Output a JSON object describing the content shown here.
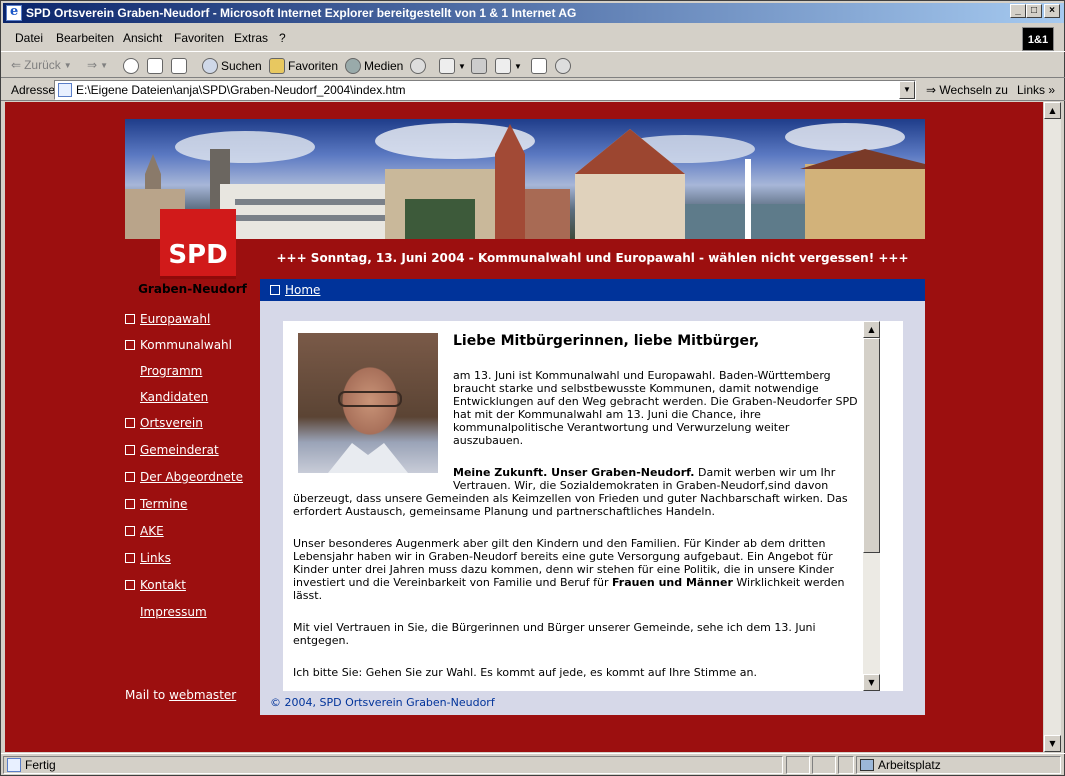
{
  "window": {
    "title": "SPD Ortsverein Graben-Neudorf - Microsoft Internet Explorer bereitgestellt von 1 & 1 Internet AG"
  },
  "menu": [
    "Datei",
    "Bearbeiten",
    "Ansicht",
    "Favoriten",
    "Extras",
    "?"
  ],
  "brand_logo": "1&1",
  "toolbar": {
    "back": "Zurück",
    "search": "Suchen",
    "favorites": "Favoriten",
    "media": "Medien"
  },
  "address": {
    "label": "Adresse",
    "value": "E:\\Eigene Dateien\\anja\\SPD\\Graben-Neudorf_2004\\index.htm",
    "go": "Wechseln zu",
    "links": "Links"
  },
  "page": {
    "logo_text": "SPD",
    "announcement": "+++ Sonntag, 13. Juni 2004 - Kommunalwahl und Europawahl - wählen nicht vergessen! +++",
    "org_name": "Graben-Neudorf",
    "nav": [
      {
        "label": "Europawahl",
        "checkbox": true,
        "link": true
      },
      {
        "label": "Kommunalwahl",
        "checkbox": true,
        "link": false
      },
      {
        "label": "Programm",
        "checkbox": false,
        "link": true,
        "sub": true
      },
      {
        "label": "Kandidaten",
        "checkbox": false,
        "link": true,
        "sub": true
      },
      {
        "label": "Ortsverein",
        "checkbox": true,
        "link": true
      },
      {
        "label": "Gemeinderat",
        "checkbox": true,
        "link": true
      },
      {
        "label": "Der Abgeordnete",
        "checkbox": true,
        "link": true
      },
      {
        "label": "Termine",
        "checkbox": true,
        "link": true
      },
      {
        "label": "AKE",
        "checkbox": true,
        "link": true
      },
      {
        "label": "Links",
        "checkbox": true,
        "link": true
      },
      {
        "label": "Kontakt",
        "checkbox": true,
        "link": true
      },
      {
        "label": "Impressum",
        "checkbox": false,
        "link": true,
        "sub": true
      }
    ],
    "mail_prefix": "Mail to",
    "mail_link": "webmaster",
    "home_link": "Home",
    "article": {
      "title": "Liebe Mitbürgerinnen, liebe Mitbürger,",
      "p1": [
        "am 13. Juni ist Kommunalwahl und Europawahl. Baden-Württemberg",
        "braucht starke und selbstbewusste Kommunen, damit notwendige",
        "Entwicklungen auf den Weg gebracht werden. Die Graben-Neudorfer SPD",
        "hat mit der Kommunalwahl am 13. Juni die Chance, ihre",
        "kommunalpolitische Verantwortung und Verwurzelung weiter",
        "auszubauen."
      ],
      "p2_bold": "Meine Zukunft. Unser Graben-Neudorf.",
      "p2_rest1": " Damit werben wir um Ihr",
      "p2": [
        "Vertrauen. Wir, die Sozialdemokraten in Graben-Neudorf,sind davon",
        "überzeugt, dass unsere Gemeinden als Keimzellen von Frieden und guter Nachbarschaft wirken. Das",
        "erfordert Austausch, gemeinsame Planung und partnerschaftliches Handeln."
      ],
      "p3": [
        "Unser besonderes Augenmerk aber gilt den Kindern und den Familien. Für Kinder ab dem dritten",
        "Lebensjahr haben wir in Graben-Neudorf bereits eine gute Versorgung aufgebaut. Ein Angebot für",
        "Kinder unter drei Jahren muss dazu kommen, denn wir stehen für eine Politik, die in unsere Kinder",
        "investiert und die Vereinbarkeit von Familie und Beruf für "
      ],
      "p3_bold": "Frauen und Männer",
      "p3_tail": " Wirklichkeit werden",
      "p3_last": "lässt.",
      "p4": [
        "Mit viel Vertrauen in Sie, die Bürgerinnen und Bürger unserer Gemeinde, sehe ich dem 13. Juni",
        "entgegen."
      ],
      "p5": "Ich bitte Sie: Gehen Sie zur Wahl. Es kommt auf jede, es kommt auf Ihre Stimme an."
    },
    "copyright": "© 2004, SPD Ortsverein Graben-Neudorf"
  },
  "status": {
    "left": "Fertig",
    "zone": "Arbeitsplatz"
  }
}
